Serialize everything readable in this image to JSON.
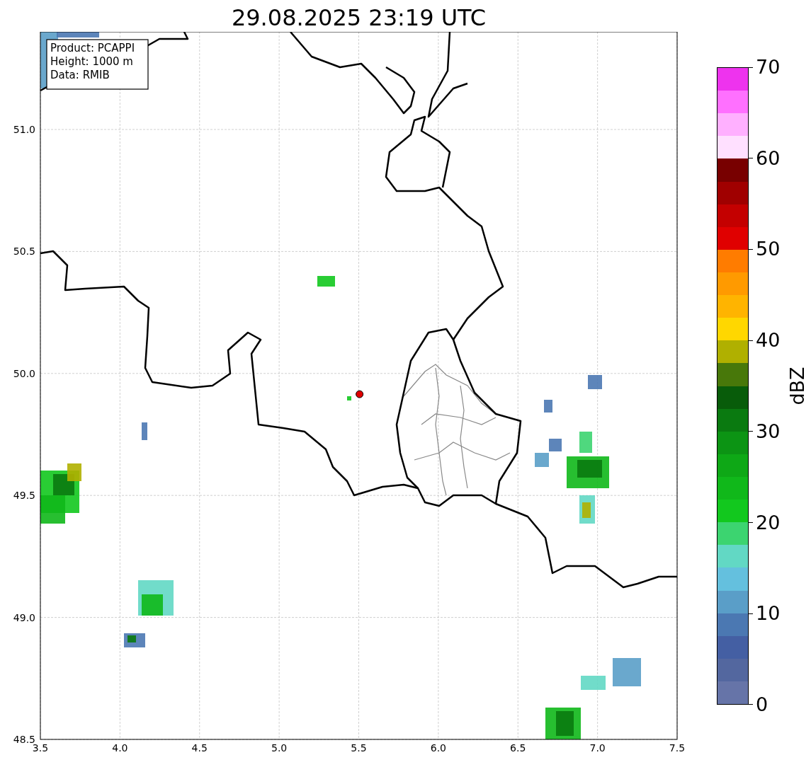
{
  "title": "29.08.2025 23:19 UTC",
  "info_box": [
    "Product: PCAPPI",
    "Height: 1000 m",
    "Data: RMIB"
  ],
  "map": {
    "xticks": [
      "3.5",
      "4.0",
      "4.5",
      "5.0",
      "5.5",
      "6.0",
      "6.5",
      "7.0",
      "7.5"
    ],
    "yticks": [
      "51.0",
      "50.5",
      "50.0",
      "49.5",
      "49.0",
      "48.5"
    ]
  },
  "colorbar": {
    "label": "dBZ",
    "ticks": [
      "70",
      "60",
      "50",
      "40",
      "30",
      "20",
      "10",
      "0"
    ],
    "bands": [
      {
        "color": "#ee33ee"
      },
      {
        "color": "#ff70ff"
      },
      {
        "color": "#ffb0ff"
      },
      {
        "color": "#ffe0ff"
      },
      {
        "color": "#780000"
      },
      {
        "color": "#a00000"
      },
      {
        "color": "#c40000"
      },
      {
        "color": "#e00000"
      },
      {
        "color": "#ff7c00"
      },
      {
        "color": "#ff9a00"
      },
      {
        "color": "#ffb400"
      },
      {
        "color": "#ffd700"
      },
      {
        "color": "#b0b000"
      },
      {
        "color": "#48780a"
      },
      {
        "color": "#085c0a"
      },
      {
        "color": "#0a7a10"
      },
      {
        "color": "#0c9414"
      },
      {
        "color": "#0ea816"
      },
      {
        "color": "#10b81a"
      },
      {
        "color": "#12c81e"
      },
      {
        "color": "#3cd470"
      },
      {
        "color": "#62d8c4"
      },
      {
        "color": "#64c0de"
      },
      {
        "color": "#5a9ec8"
      },
      {
        "color": "#4b78b2"
      },
      {
        "color": "#445fa3"
      },
      {
        "color": "#53679f"
      },
      {
        "color": "#6674a8"
      }
    ]
  }
}
